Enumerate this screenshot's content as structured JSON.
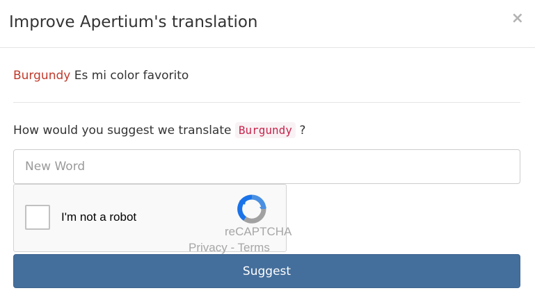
{
  "modal": {
    "title": "Improve Apertium's translation",
    "close_label": "×"
  },
  "source": {
    "unknown_word": "Burgundy",
    "rest": " Es mi color favorito"
  },
  "question": {
    "prefix": "How would you suggest we translate ",
    "word": "Burgundy",
    "suffix": " ?"
  },
  "input": {
    "placeholder": "New Word",
    "value": ""
  },
  "recaptcha": {
    "label": "I'm not a robot",
    "brand": "reCAPTCHA",
    "privacy": "Privacy",
    "separator": " - ",
    "terms": "Terms",
    "logo_icon": "recaptcha-logo-icon",
    "checked": false
  },
  "actions": {
    "suggest_label": "Suggest"
  },
  "colors": {
    "accent": "#446e9b",
    "unknown_word": "#c0392b",
    "code_text": "#c7254e",
    "code_bg": "#f9f2f4"
  }
}
